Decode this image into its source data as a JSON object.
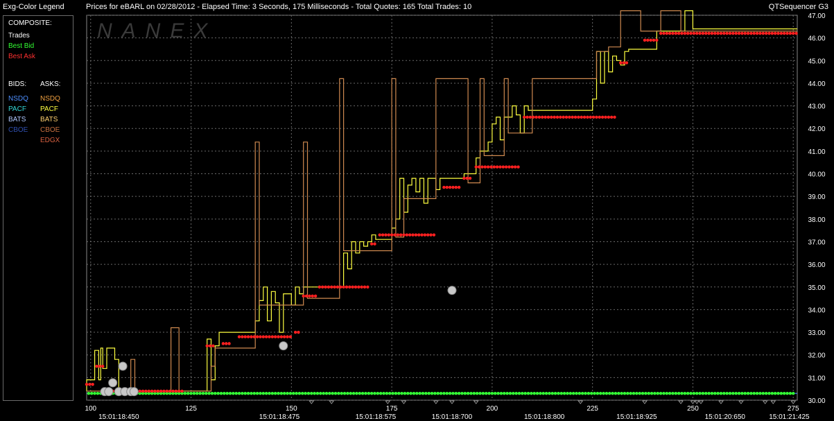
{
  "header": {
    "legend_title": "Exg-Color Legend",
    "title": "Prices for  eBARL  on  02/28/2012  -  Elapsed Time: 3 Seconds, 175 Milliseconds  -  Total Quotes: 165  Total Trades: 10",
    "app": "QTSequencer G3"
  },
  "legend": {
    "composite_label": "COMPOSITE:",
    "trades": "Trades",
    "best_bid": "Best Bid",
    "best_ask": "Best Ask",
    "bids_label": "BIDS:",
    "asks_label": "ASKS:",
    "bids": [
      {
        "name": "NSDQ",
        "color": "#4d8fff"
      },
      {
        "name": "PACF",
        "color": "#33d6d6"
      },
      {
        "name": "BATS",
        "color": "#b0c8ff"
      },
      {
        "name": "CBOE",
        "color": "#3050b0"
      }
    ],
    "asks": [
      {
        "name": "NSDQ",
        "color": "#f0a040"
      },
      {
        "name": "PACF",
        "color": "#ffff40"
      },
      {
        "name": "BATS",
        "color": "#ffd070"
      },
      {
        "name": "CBOE",
        "color": "#c87040"
      },
      {
        "name": "EDGX",
        "color": "#d86040"
      }
    ],
    "colors": {
      "trades": "#ffffff",
      "best_bid": "#33ff33",
      "best_ask": "#ff3030"
    }
  },
  "chart_data": {
    "type": "line",
    "watermark": "NANEX",
    "x_range": [
      99,
      276
    ],
    "ylim": [
      30,
      47
    ],
    "y_ticks": [
      "30.00",
      "31.00",
      "32.00",
      "33.00",
      "34.00",
      "35.00",
      "36.00",
      "37.00",
      "38.00",
      "39.00",
      "40.00",
      "41.00",
      "42.00",
      "43.00",
      "44.00",
      "45.00",
      "46.00",
      "47.00"
    ],
    "x_ticks": [
      {
        "x": 100,
        "label": "100"
      },
      {
        "x": 125,
        "label": "125"
      },
      {
        "x": 150,
        "label": "150"
      },
      {
        "x": 175,
        "label": "175"
      },
      {
        "x": 200,
        "label": "200"
      },
      {
        "x": 225,
        "label": "225"
      },
      {
        "x": 250,
        "label": "250"
      },
      {
        "x": 275,
        "label": "275"
      }
    ],
    "time_labels": [
      {
        "x": 107,
        "label": "15:01:18:450"
      },
      {
        "x": 147,
        "label": "15:01:18:475"
      },
      {
        "x": 171,
        "label": "15:01:18:575"
      },
      {
        "x": 190,
        "label": "15:01:18:700"
      },
      {
        "x": 213,
        "label": "15:01:18:800"
      },
      {
        "x": 236,
        "label": "15:01:18:925"
      },
      {
        "x": 258,
        "label": "15:01:20:650"
      },
      {
        "x": 274,
        "label": "15:01:21:425"
      }
    ],
    "best_bid": {
      "value": 30.3
    },
    "best_ask": {
      "steps": [
        [
          99,
          30.7
        ],
        [
          101,
          30.7
        ],
        [
          101.5,
          31.5
        ],
        [
          103,
          31.5
        ],
        [
          104,
          30.4
        ],
        [
          123,
          30.4
        ],
        [
          127,
          30.7
        ],
        [
          128,
          31
        ],
        [
          129,
          32.4
        ],
        [
          131,
          32.4
        ],
        [
          132,
          32
        ],
        [
          133,
          32.5
        ],
        [
          135,
          32.5
        ],
        [
          137,
          32.8
        ],
        [
          150,
          32.8
        ],
        [
          151,
          33
        ],
        [
          152,
          33
        ],
        [
          153,
          34.6
        ],
        [
          156,
          34.6
        ],
        [
          157,
          35
        ],
        [
          169,
          35
        ],
        [
          170,
          36.9
        ],
        [
          171,
          36.9
        ],
        [
          172,
          37.3
        ],
        [
          186,
          37.3
        ],
        [
          188,
          39.4
        ],
        [
          192,
          39.4
        ],
        [
          193,
          39.8
        ],
        [
          195,
          39.8
        ],
        [
          196,
          40.3
        ],
        [
          207,
          40.3
        ],
        [
          208,
          42.5
        ],
        [
          231,
          42.5
        ],
        [
          232,
          44.9
        ],
        [
          234,
          44.9
        ],
        [
          235,
          45.2
        ],
        [
          237,
          45.4
        ],
        [
          238,
          45.9
        ],
        [
          241,
          45.9
        ],
        [
          242,
          46.2
        ],
        [
          276,
          46.2
        ]
      ]
    },
    "series": [
      {
        "color": "#ffff40",
        "steps": [
          [
            99,
            30.4
          ],
          [
            99,
            30.9
          ],
          [
            101,
            30.9
          ],
          [
            101,
            32.2
          ],
          [
            102,
            32.2
          ],
          [
            102,
            30.9
          ],
          [
            102.5,
            30.9
          ],
          [
            102.5,
            32.3
          ],
          [
            103,
            32.3
          ],
          [
            103,
            31.4
          ],
          [
            104,
            31.4
          ],
          [
            104,
            32.3
          ],
          [
            106,
            32.3
          ],
          [
            106,
            31.8
          ],
          [
            107,
            31.8
          ],
          [
            107,
            30.4
          ],
          [
            129,
            30.4
          ],
          [
            129,
            32.7
          ],
          [
            130,
            32.7
          ],
          [
            130,
            30.9
          ],
          [
            131,
            30.9
          ],
          [
            131,
            32.4
          ],
          [
            132,
            32.4
          ],
          [
            132,
            33
          ],
          [
            141,
            33
          ],
          [
            141,
            33.5
          ],
          [
            142,
            33.5
          ],
          [
            142,
            34.4
          ],
          [
            143,
            34.4
          ],
          [
            143,
            35
          ],
          [
            144,
            35
          ],
          [
            144,
            33.5
          ],
          [
            145,
            33.5
          ],
          [
            145,
            34.8
          ],
          [
            146,
            34.8
          ],
          [
            146,
            34.3
          ],
          [
            147,
            34.3
          ],
          [
            147,
            33
          ],
          [
            148,
            33
          ],
          [
            148,
            34.7
          ],
          [
            150,
            34.7
          ],
          [
            150,
            34.2
          ],
          [
            151,
            34.2
          ],
          [
            151,
            35
          ],
          [
            152,
            35
          ],
          [
            152,
            34.7
          ],
          [
            153,
            34.7
          ],
          [
            153,
            35
          ],
          [
            163,
            35
          ],
          [
            163,
            36.5
          ],
          [
            164,
            36.5
          ],
          [
            164,
            35.8
          ],
          [
            165,
            35.8
          ],
          [
            165,
            37
          ],
          [
            166,
            37
          ],
          [
            166,
            36.5
          ],
          [
            167,
            36.5
          ],
          [
            167,
            37
          ],
          [
            168,
            37
          ],
          [
            168,
            36.8
          ],
          [
            169,
            36.8
          ],
          [
            169,
            37
          ],
          [
            170,
            37
          ],
          [
            170,
            37.3
          ],
          [
            171,
            37.3
          ],
          [
            171,
            37.1
          ],
          [
            175,
            37.1
          ],
          [
            175,
            37.6
          ],
          [
            176,
            37.6
          ],
          [
            176,
            38
          ],
          [
            177,
            38
          ],
          [
            177,
            39.8
          ],
          [
            178,
            39.8
          ],
          [
            178,
            38.3
          ],
          [
            179,
            38.3
          ],
          [
            179,
            39.5
          ],
          [
            180,
            39.5
          ],
          [
            180,
            39.8
          ],
          [
            181,
            39.8
          ],
          [
            181,
            39.2
          ],
          [
            182,
            39.2
          ],
          [
            182,
            39.8
          ],
          [
            183,
            39.8
          ],
          [
            183,
            38.7
          ],
          [
            184,
            38.7
          ],
          [
            184,
            39.8
          ],
          [
            186,
            39.8
          ],
          [
            186,
            39.3
          ],
          [
            187,
            39.3
          ],
          [
            187,
            39.8
          ],
          [
            193,
            39.8
          ],
          [
            193,
            40
          ],
          [
            196,
            40
          ],
          [
            196,
            40.7
          ],
          [
            197,
            40.7
          ],
          [
            197,
            41
          ],
          [
            199,
            41
          ],
          [
            199,
            41.4
          ],
          [
            200,
            41.4
          ],
          [
            200,
            42.2
          ],
          [
            201,
            42.2
          ],
          [
            201,
            42.5
          ],
          [
            202,
            42.5
          ],
          [
            202,
            41.5
          ],
          [
            203,
            41.5
          ],
          [
            203,
            42.5
          ],
          [
            205,
            42.5
          ],
          [
            205,
            43
          ],
          [
            206,
            43
          ],
          [
            206,
            42.6
          ],
          [
            207,
            42.6
          ],
          [
            207,
            41.8
          ],
          [
            208,
            41.8
          ],
          [
            208,
            43
          ],
          [
            209,
            43
          ],
          [
            209,
            42.8
          ],
          [
            225,
            42.8
          ],
          [
            225,
            43.3
          ],
          [
            226,
            43.3
          ],
          [
            226,
            45.4
          ],
          [
            227,
            45.4
          ],
          [
            227,
            44
          ],
          [
            228,
            44
          ],
          [
            228,
            45.4
          ],
          [
            229,
            45.4
          ],
          [
            229,
            44.5
          ],
          [
            230,
            44.5
          ],
          [
            230,
            45.2
          ],
          [
            231,
            45.2
          ],
          [
            231,
            45
          ],
          [
            232,
            45
          ],
          [
            232,
            44.8
          ],
          [
            233,
            44.8
          ],
          [
            233,
            45.4
          ],
          [
            234,
            45.4
          ],
          [
            234,
            45.5
          ],
          [
            241,
            45.5
          ],
          [
            241,
            46.3
          ],
          [
            248,
            46.3
          ],
          [
            248,
            47.2
          ],
          [
            250,
            47.2
          ],
          [
            250,
            46.4
          ],
          [
            276,
            46.4
          ]
        ]
      },
      {
        "color": "#d08a50",
        "steps": [
          [
            99,
            30.4
          ],
          [
            110,
            30.4
          ],
          [
            110,
            31.8
          ],
          [
            111,
            31.8
          ],
          [
            111,
            30.4
          ],
          [
            120,
            30.4
          ],
          [
            120,
            33.2
          ],
          [
            122,
            33.2
          ],
          [
            122,
            30.4
          ],
          [
            130,
            30.4
          ],
          [
            130,
            31.5
          ],
          [
            131,
            31.5
          ],
          [
            131,
            32.3
          ],
          [
            141,
            32.3
          ],
          [
            141,
            41.4
          ],
          [
            142,
            41.4
          ],
          [
            142,
            34.2
          ],
          [
            153,
            34.2
          ],
          [
            153,
            41.4
          ],
          [
            154,
            41.4
          ],
          [
            154,
            34.5
          ],
          [
            162,
            34.5
          ],
          [
            162,
            44.2
          ],
          [
            163,
            44.2
          ],
          [
            163,
            36.6
          ],
          [
            175,
            36.6
          ],
          [
            175,
            44.2
          ],
          [
            176,
            44.2
          ],
          [
            176,
            37.2
          ],
          [
            178,
            37.2
          ],
          [
            178,
            38.9
          ],
          [
            186,
            38.9
          ],
          [
            186,
            44.2
          ],
          [
            194,
            44.2
          ],
          [
            194,
            39.6
          ],
          [
            197,
            39.6
          ],
          [
            197,
            44.2
          ],
          [
            198,
            44.2
          ],
          [
            198,
            40.8
          ],
          [
            203,
            40.8
          ],
          [
            203,
            44.2
          ],
          [
            204,
            44.2
          ],
          [
            204,
            41.8
          ],
          [
            210,
            41.8
          ],
          [
            210,
            44.2
          ],
          [
            226,
            44.2
          ],
          [
            226,
            45.4
          ],
          [
            229,
            45.4
          ],
          [
            229,
            45.6
          ],
          [
            232,
            45.6
          ],
          [
            232,
            47.2
          ],
          [
            237,
            47.2
          ],
          [
            237,
            46.3
          ],
          [
            242,
            46.3
          ],
          [
            242,
            47.2
          ],
          [
            247,
            47.2
          ],
          [
            247,
            46.3
          ],
          [
            276,
            46.3
          ]
        ]
      }
    ],
    "trades": [
      {
        "x": 103.5,
        "y": 30.38
      },
      {
        "x": 104.5,
        "y": 30.38
      },
      {
        "x": 105.5,
        "y": 30.77
      },
      {
        "x": 107,
        "y": 30.38
      },
      {
        "x": 108,
        "y": 31.5
      },
      {
        "x": 108.5,
        "y": 30.38
      },
      {
        "x": 110,
        "y": 30.38
      },
      {
        "x": 110.8,
        "y": 30.38
      },
      {
        "x": 148,
        "y": 32.4
      },
      {
        "x": 190,
        "y": 34.85
      }
    ],
    "bottom_markers": [
      155,
      160,
      174,
      178,
      186,
      190,
      196,
      222,
      238,
      247,
      250,
      251,
      252,
      257,
      262,
      268,
      270,
      275
    ]
  }
}
